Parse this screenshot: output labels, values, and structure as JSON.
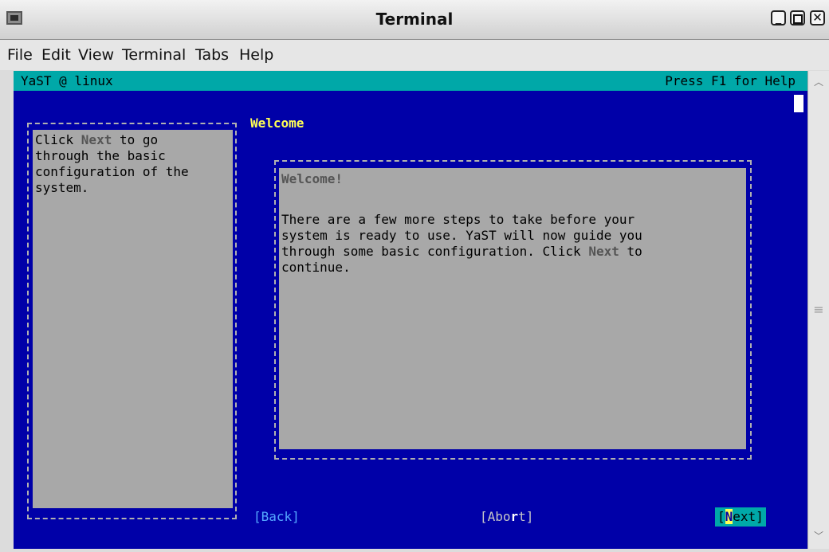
{
  "window": {
    "title": "Terminal"
  },
  "menubar": {
    "items": [
      "File",
      "Edit",
      "View",
      "Terminal",
      "Tabs",
      "Help"
    ]
  },
  "yast": {
    "status_left": "YaST @ linux",
    "status_right": "Press F1 for Help",
    "heading": "Welcome",
    "help_text": {
      "part1": "Click ",
      "hot": "Next",
      "part2": " to go\nthrough the basic\nconfiguration of the\nsystem."
    },
    "content": {
      "title": "Welcome!",
      "body_part1": "There are a few more steps to take before your\nsystem is ready to use. YaST will now guide you\nthrough some basic configuration. Click ",
      "body_hot": "Next",
      "body_part2": " to\ncontinue."
    },
    "buttons": {
      "back": "[Back]",
      "abort_a": "[Abo",
      "abort_r": "r",
      "abort_b": "t]",
      "next_open": "[",
      "next_hot": "N",
      "next_rest": "ext]"
    }
  },
  "colors": {
    "terminal_bg": "#0000a8",
    "status_bar": "#00a8a8",
    "panel": "#a8a8a8",
    "heading": "#ffff55"
  }
}
